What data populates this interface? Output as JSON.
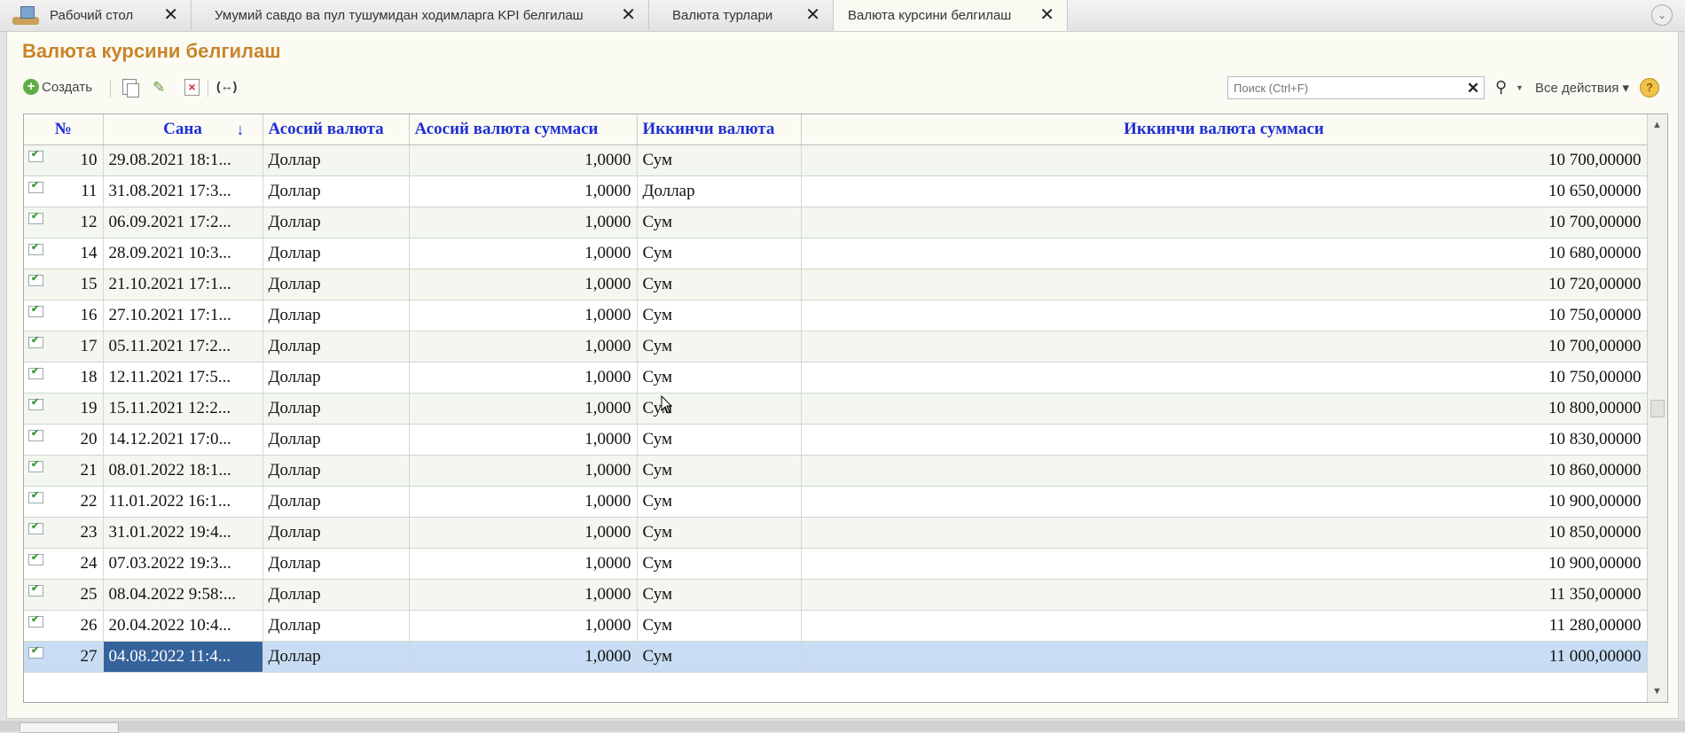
{
  "tabs": [
    {
      "label": "Рабочий стол",
      "active": false
    },
    {
      "label": "Умумий савдо ва пул тушумидан ходимларга  KPI  белгилаш",
      "active": false
    },
    {
      "label": "Валюта турлари",
      "active": false
    },
    {
      "label": "Валюта курсини белгилаш",
      "active": true
    }
  ],
  "page": {
    "title": "Валюта курсини белгилаш"
  },
  "toolbar": {
    "create_label": "Создать",
    "search_placeholder": "Поиск (Ctrl+F)",
    "all_actions_label": "Все действия ▾",
    "clear_symbol": "✕",
    "icons": [
      "add-icon",
      "copy-icon",
      "edit-pencil-icon",
      "delete-icon",
      "set-interval-icon",
      "search-icon",
      "help-icon"
    ]
  },
  "table": {
    "columns": [
      "№",
      "Сана",
      "Асосий валюта",
      "Асосий валюта суммаси",
      "Иккинчи валюта",
      "Иккинчи валюта суммаси"
    ],
    "sort_indicator": "↓",
    "selected_row": 16,
    "rows": [
      {
        "num": "10",
        "date": "29.08.2021 18:1...",
        "base": "Доллар",
        "base_sum": "1,0000",
        "second": "Сум",
        "second_sum": "10 700,00000"
      },
      {
        "num": "11",
        "date": "31.08.2021 17:3...",
        "base": "Доллар",
        "base_sum": "1,0000",
        "second": "Доллар",
        "second_sum": "10 650,00000"
      },
      {
        "num": "12",
        "date": "06.09.2021 17:2...",
        "base": "Доллар",
        "base_sum": "1,0000",
        "second": "Сум",
        "second_sum": "10 700,00000"
      },
      {
        "num": "14",
        "date": "28.09.2021 10:3...",
        "base": "Доллар",
        "base_sum": "1,0000",
        "second": "Сум",
        "second_sum": "10 680,00000"
      },
      {
        "num": "15",
        "date": "21.10.2021 17:1...",
        "base": "Доллар",
        "base_sum": "1,0000",
        "second": "Сум",
        "second_sum": "10 720,00000"
      },
      {
        "num": "16",
        "date": "27.10.2021 17:1...",
        "base": "Доллар",
        "base_sum": "1,0000",
        "second": "Сум",
        "second_sum": "10 750,00000"
      },
      {
        "num": "17",
        "date": "05.11.2021 17:2...",
        "base": "Доллар",
        "base_sum": "1,0000",
        "second": "Сум",
        "second_sum": "10 700,00000"
      },
      {
        "num": "18",
        "date": "12.11.2021 17:5...",
        "base": "Доллар",
        "base_sum": "1,0000",
        "second": "Сум",
        "second_sum": "10 750,00000"
      },
      {
        "num": "19",
        "date": "15.11.2021 12:2...",
        "base": "Доллар",
        "base_sum": "1,0000",
        "second": "Сум",
        "second_sum": "10 800,00000"
      },
      {
        "num": "20",
        "date": "14.12.2021 17:0...",
        "base": "Доллар",
        "base_sum": "1,0000",
        "second": "Сум",
        "second_sum": "10 830,00000"
      },
      {
        "num": "21",
        "date": "08.01.2022 18:1...",
        "base": "Доллар",
        "base_sum": "1,0000",
        "second": "Сум",
        "second_sum": "10 860,00000"
      },
      {
        "num": "22",
        "date": "11.01.2022 16:1...",
        "base": "Доллар",
        "base_sum": "1,0000",
        "second": "Сум",
        "second_sum": "10 900,00000"
      },
      {
        "num": "23",
        "date": "31.01.2022 19:4...",
        "base": "Доллар",
        "base_sum": "1,0000",
        "second": "Сум",
        "second_sum": "10 850,00000"
      },
      {
        "num": "24",
        "date": "07.03.2022 19:3...",
        "base": "Доллар",
        "base_sum": "1,0000",
        "second": "Сум",
        "second_sum": "10 900,00000"
      },
      {
        "num": "25",
        "date": "08.04.2022 9:58:...",
        "base": "Доллар",
        "base_sum": "1,0000",
        "second": "Сум",
        "second_sum": "11 350,00000"
      },
      {
        "num": "26",
        "date": "20.04.2022 10:4...",
        "base": "Доллар",
        "base_sum": "1,0000",
        "second": "Сум",
        "second_sum": "11 280,00000"
      },
      {
        "num": "27",
        "date": "04.08.2022 11:4...",
        "base": "Доллар",
        "base_sum": "1,0000",
        "second": "Сум",
        "second_sum": "11 000,00000"
      }
    ]
  },
  "colors": {
    "title": "#c9852a",
    "header_text": "#1f2fd6",
    "selected_row": "#c8dcf3",
    "selected_cell": "#36629c"
  }
}
